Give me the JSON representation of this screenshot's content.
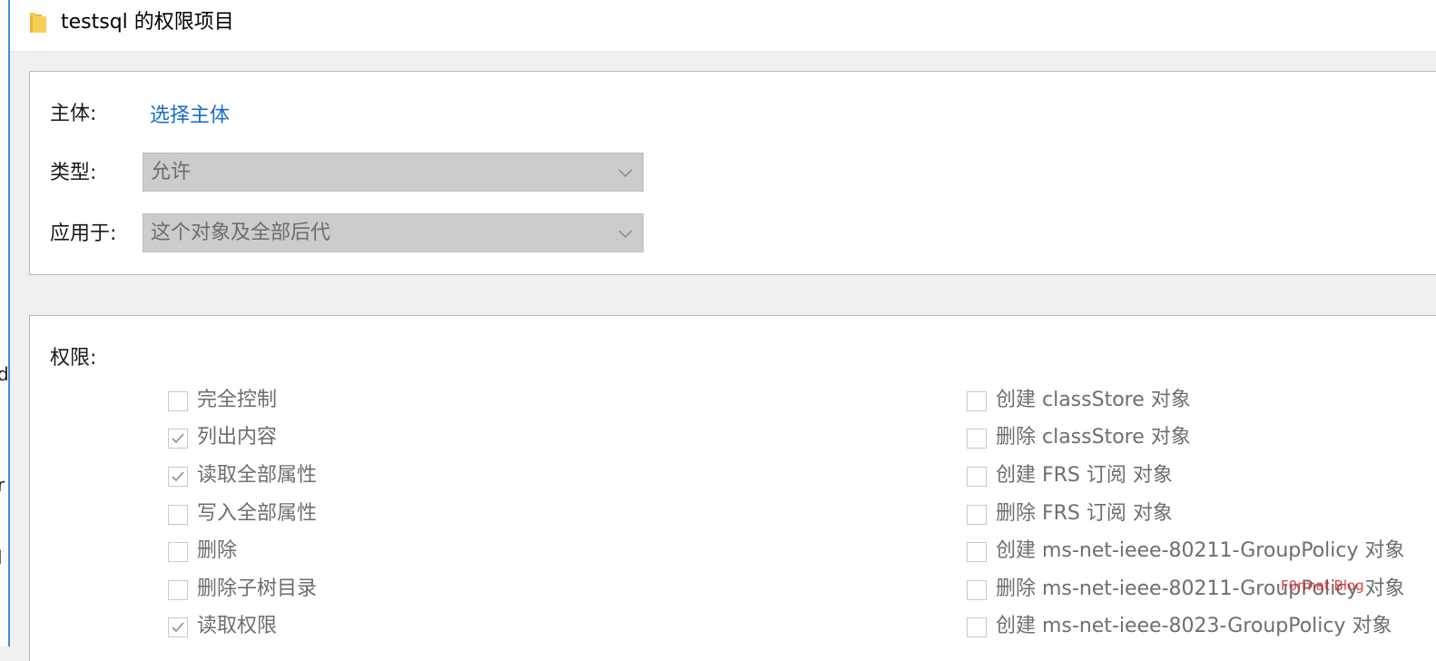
{
  "window": {
    "title": "testsql 的权限项目",
    "icon": "folder-icon",
    "edge_glyphs": [
      "d",
      "r",
      "l"
    ]
  },
  "principal": {
    "label": "主体:",
    "link": "选择主体"
  },
  "type": {
    "label": "类型:",
    "value": "允许"
  },
  "applies_to": {
    "label": "应用于:",
    "value": "这个对象及全部后代"
  },
  "permissions": {
    "label": "权限:",
    "left": [
      {
        "label": "完全控制",
        "checked": false
      },
      {
        "label": "列出内容",
        "checked": true
      },
      {
        "label": "读取全部属性",
        "checked": true
      },
      {
        "label": "写入全部属性",
        "checked": false
      },
      {
        "label": "删除",
        "checked": false
      },
      {
        "label": "删除子树目录",
        "checked": false
      },
      {
        "label": "读取权限",
        "checked": true
      }
    ],
    "right": [
      {
        "label": "创建 classStore 对象",
        "checked": false
      },
      {
        "label": "删除 classStore 对象",
        "checked": false
      },
      {
        "label": "创建 FRS 订阅 对象",
        "checked": false
      },
      {
        "label": "删除 FRS 订阅 对象",
        "checked": false
      },
      {
        "label": "创建 ms-net-ieee-80211-GroupPolicy 对象",
        "checked": false
      },
      {
        "label": "删除 ms-net-ieee-80211-GroupPolicy 对象",
        "checked": false
      },
      {
        "label": "创建 ms-net-ieee-8023-GroupPolicy 对象",
        "checked": false
      }
    ]
  },
  "watermark": "F0rmat Blog",
  "colors": {
    "link": "#1a6dc6",
    "disabled_text": "#6e6e6e",
    "select_bg": "#cccccc",
    "window_edge": "#3c8fd8",
    "watermark": "#e02020"
  }
}
